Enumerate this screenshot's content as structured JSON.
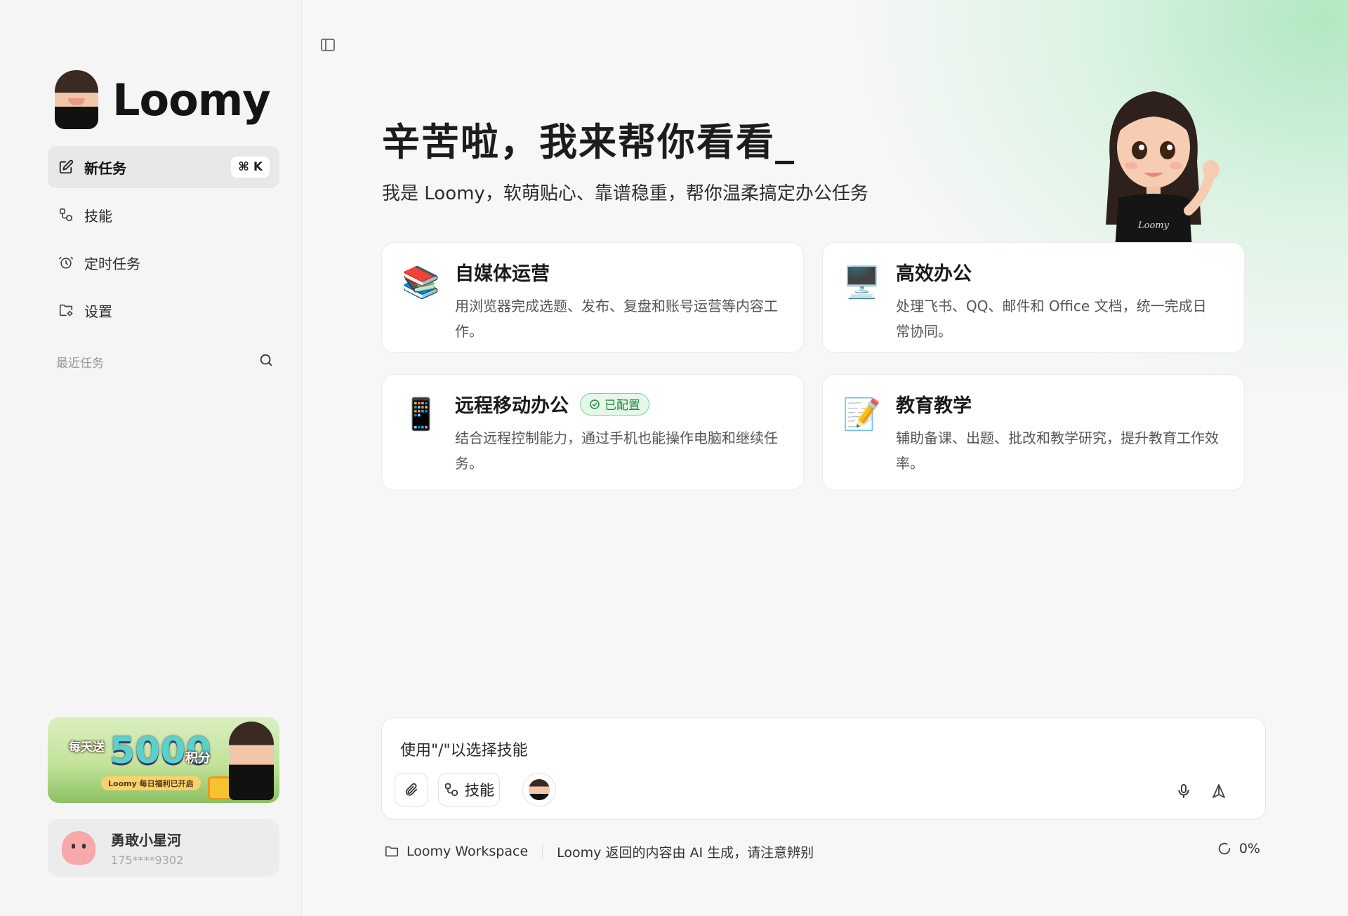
{
  "app": {
    "name": "Loomy"
  },
  "sidebar": {
    "nav": [
      {
        "label": "新任务",
        "icon": "edit-icon",
        "shortcut": "⌘ K",
        "active": true
      },
      {
        "label": "技能",
        "icon": "skills-icon"
      },
      {
        "label": "定时任务",
        "icon": "alarm-icon"
      },
      {
        "label": "设置",
        "icon": "folder-settings-icon"
      }
    ],
    "recent_label": "最近任务",
    "banner": {
      "prefix": "每天送",
      "amount": "5000",
      "unit": "积分",
      "subtitle": "Loomy 每日福利已开启"
    },
    "user": {
      "name": "勇敢小星河",
      "phone": "175****9302"
    }
  },
  "hero": {
    "title": "辛苦啦，我来帮你看看_",
    "subtitle": "我是 Loomy，软萌贴心、靠谱稳重，帮你温柔搞定办公任务"
  },
  "cards": [
    {
      "emoji": "📚",
      "icon": "books-icon",
      "title": "自媒体运营",
      "desc": "用浏览器完成选题、发布、复盘和账号运营等内容工作。"
    },
    {
      "emoji": "🖥️",
      "icon": "desktop-icon",
      "title": "高效办公",
      "desc": "处理飞书、QQ、邮件和 Office 文档，统一完成日常协同。"
    },
    {
      "emoji": "📱",
      "icon": "phone-icon",
      "title": "远程移动办公",
      "badge": "已配置",
      "desc": "结合远程控制能力，通过手机也能操作电脑和继续任务。"
    },
    {
      "emoji": "📝",
      "icon": "memo-icon",
      "title": "教育教学",
      "desc": "辅助备课、出题、批改和教学研究，提升教育工作效率。"
    }
  ],
  "composer": {
    "placeholder": "使用\"/\"以选择技能",
    "skills_label": "技能"
  },
  "footer": {
    "workspace": "Loomy Workspace",
    "disclaimer": "Loomy 返回的内容由 AI 生成，请注意辨别",
    "progress": "0%"
  }
}
